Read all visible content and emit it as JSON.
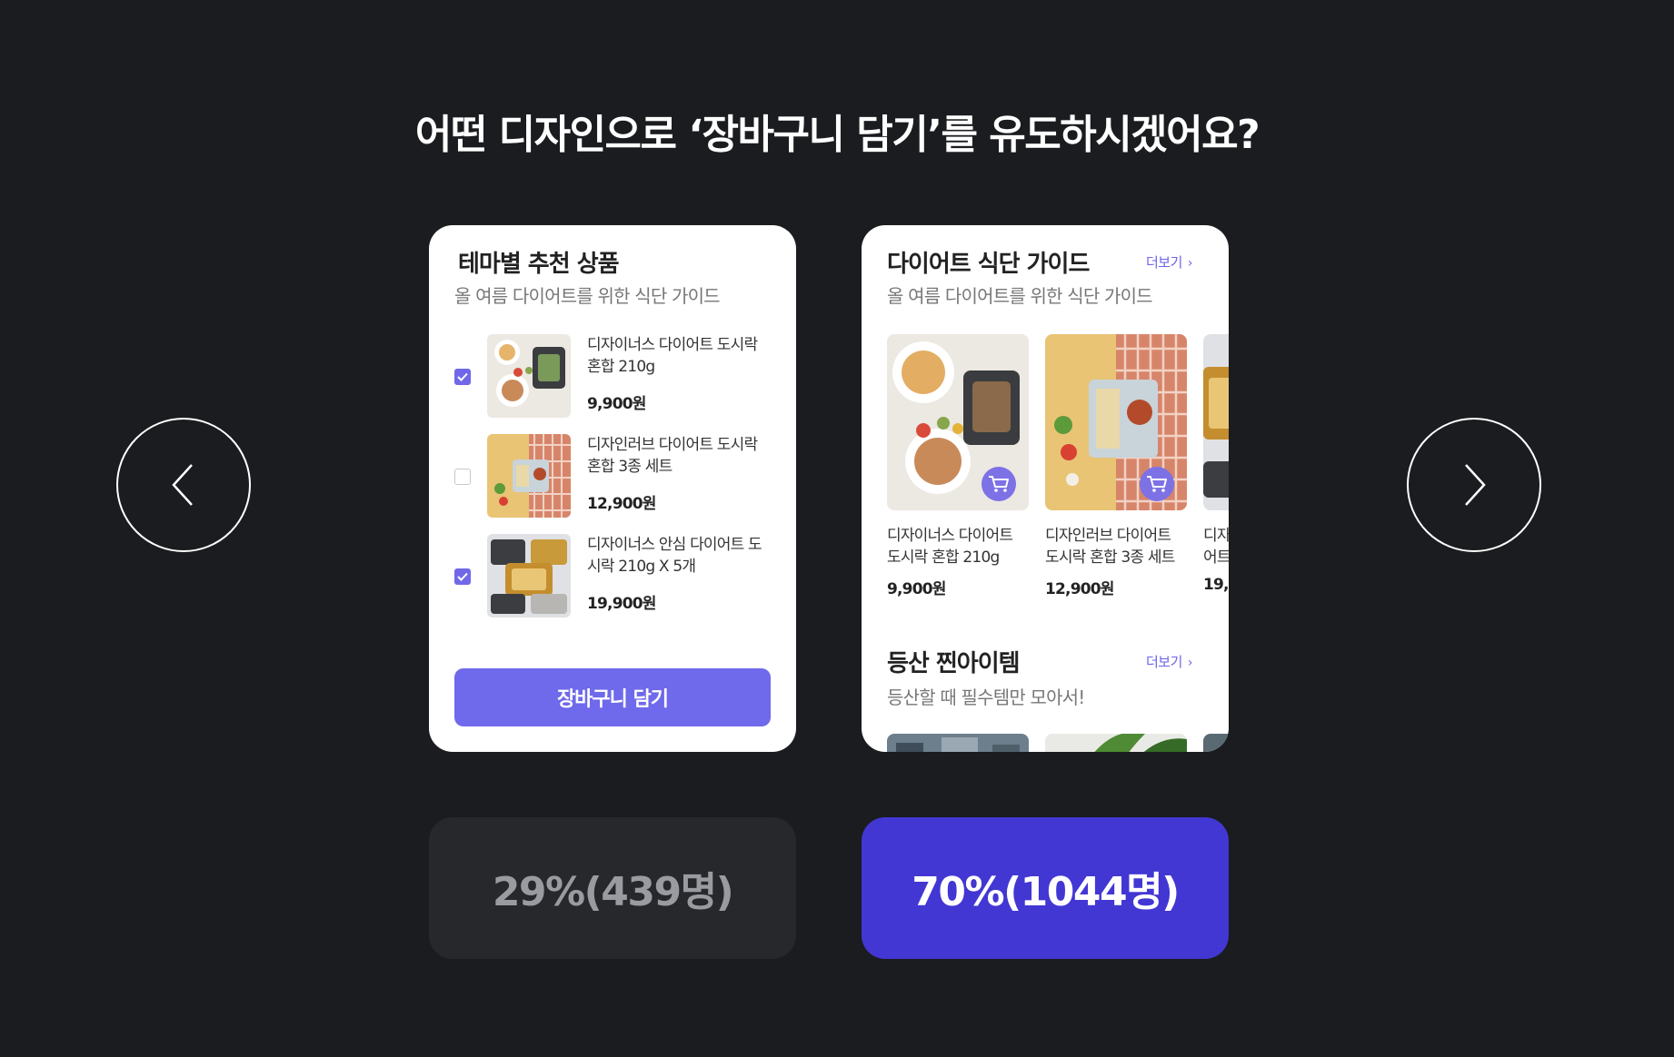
{
  "question": "어떤 디자인으로 ‘장바구니 담기’를 유도하시겠어요?",
  "nav": {
    "prev_icon": "chevron-left-icon",
    "next_icon": "chevron-right-icon"
  },
  "option_a": {
    "title": "테마별 추천 상품",
    "subtitle": "올 여름 다이어트를 위한 식단 가이드",
    "items": [
      {
        "checked": true,
        "name_line1": "디자이너스 다이어트 도시락",
        "name_line2": "혼합 210g",
        "price": "9,900원"
      },
      {
        "checked": false,
        "name_line1": "디자인러브 다이어트 도시락",
        "name_line2": "혼합 3종 세트",
        "price": "12,900원"
      },
      {
        "checked": true,
        "name_line1": "디자이너스 안심 다이어트 도",
        "name_line2": "시락 210g X 5개",
        "price": "19,900원"
      }
    ],
    "cta": "장바구니 담기",
    "result": "29%(439명)"
  },
  "option_b": {
    "section1": {
      "title": "다이어트 식단 가이드",
      "subtitle": "올 여름 다이어트를 위한 식단 가이드",
      "more": "더보기",
      "products": [
        {
          "name_line1": "디자이너스 다이어트",
          "name_line2": "도시락 혼합 210g",
          "price": "9,900원"
        },
        {
          "name_line1": "디자인러브 다이어트",
          "name_line2": "도시락 혼합 3종 세트",
          "price": "12,900원"
        },
        {
          "name_line1": "디자",
          "name_line2": "어트",
          "price": "19,9"
        }
      ]
    },
    "section2": {
      "title": "등산 찐아이템",
      "subtitle": "등산할 때 필수템만 모아서!",
      "more": "더보기"
    },
    "result": "70%(1044명)"
  },
  "colors": {
    "background": "#1b1c1f",
    "accent": "#6f69eb",
    "result_selected": "#4237d3",
    "result_other": "#27282c"
  }
}
